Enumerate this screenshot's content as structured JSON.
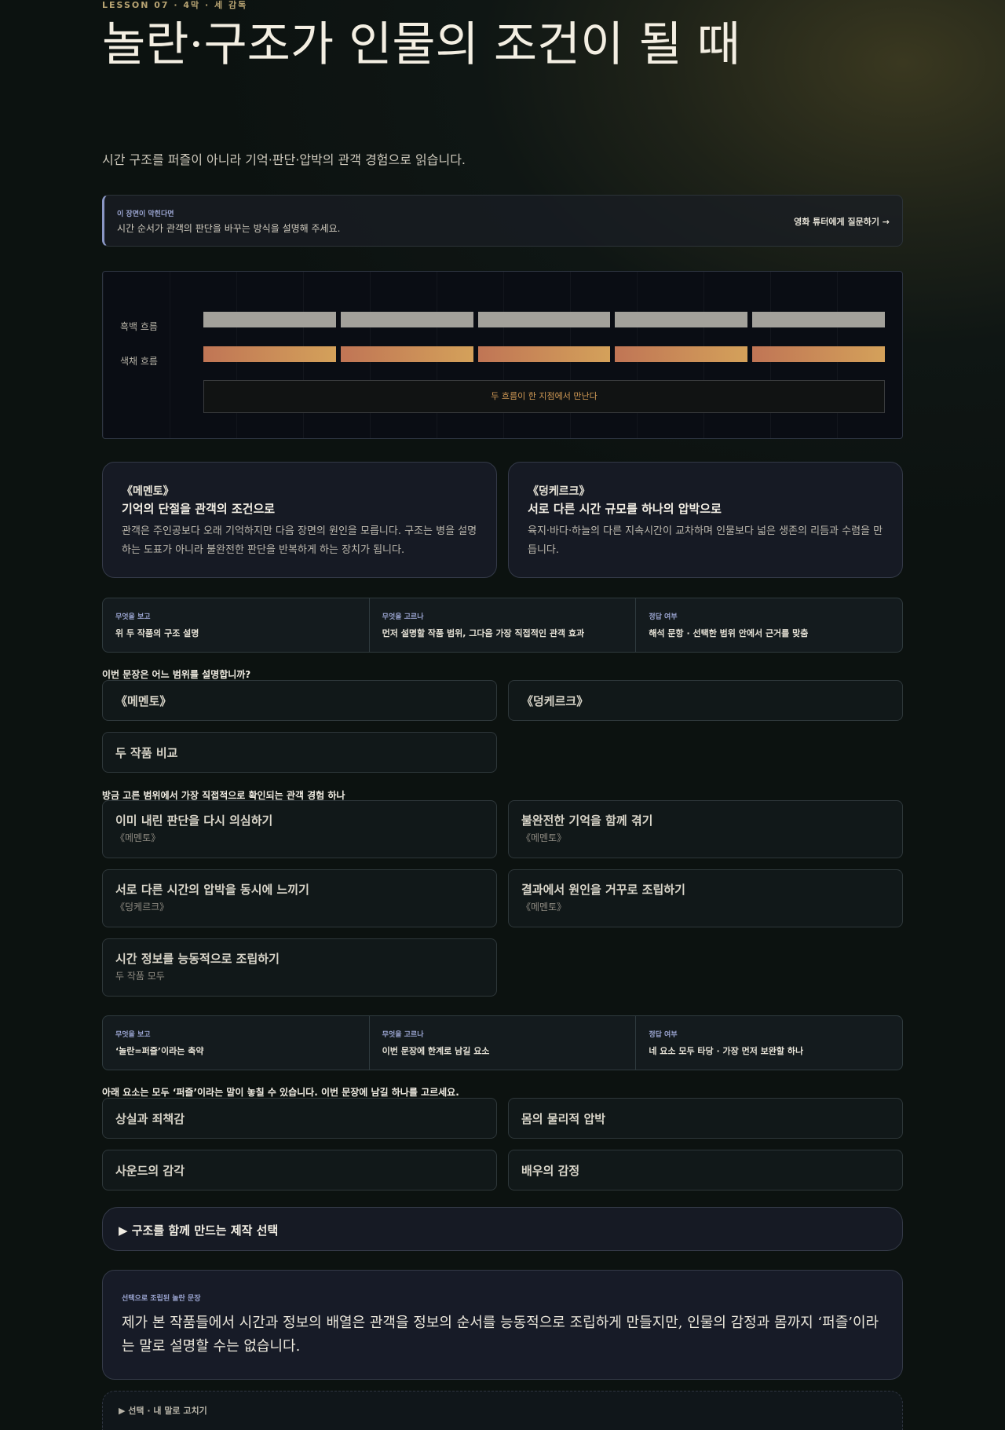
{
  "lesson": {
    "eyebrow": "LESSON 07 · 4막 · 세 감독"
  },
  "title": "놀란·구조가 인물의 조건이 될 때",
  "subtitle": "시간 구조를 퍼즐이 아니라 기억·판단·압박의 관객 경험으로 읽습니다.",
  "help": {
    "kicker": "이 장면이 막힌다면",
    "text": "시간 순서가 관객의 판단을 바꾸는 방식을 설명해 주세요.",
    "button": "영화 튜터에게 질문하기 →"
  },
  "timeline": {
    "row_bw": "흑백 흐름",
    "row_color": "색채 흐름",
    "meet": "두 흐름이 한 지점에서 만난다",
    "segments": 5,
    "colors": {
      "bw": "#a3a19b",
      "color_start": "#c07555",
      "color_end": "#d4a15a",
      "meet_text": "#d19a55"
    }
  },
  "films": [
    {
      "title": "《메멘토》",
      "heading": "기억의 단절을 관객의 조건으로",
      "body": "관객은 주인공보다 오래 기억하지만 다음 장면의 원인을 모릅니다. 구조는 병을 설명하는 도표가 아니라 불완전한 판단을 반복하게 하는 장치가 됩니다."
    },
    {
      "title": "《덩케르크》",
      "heading": "서로 다른 시간 규모를 하나의 압박으로",
      "body": "육지·바다·하늘의 다른 지속시간이 교차하며 인물보다 넓은 생존의 리듬과 수렴을 만듭니다."
    }
  ],
  "info1": {
    "cells": [
      {
        "k": "무엇을 보고",
        "v": "위 두 작품의 구조 설명"
      },
      {
        "k": "무엇을 고르나",
        "v": "먼저 설명할 작품 범위, 그다음 가장 직접적인 관객 효과"
      },
      {
        "k": "정답 여부",
        "v": "해석 문항 · 선택한 범위 안에서 근거를 맞춤"
      }
    ]
  },
  "q1": {
    "prompt": "이번 문장은 어느 범위를 설명합니까?",
    "options": [
      "《메멘토》",
      "《덩케르크》",
      "두 작품 비교"
    ]
  },
  "q2": {
    "prompt": "방금 고른 범위에서 가장 직접적으로 확인되는 관객 경험 하나",
    "options": [
      {
        "label": "이미 내린 판단을 다시 의심하기",
        "sub": "《메멘토》"
      },
      {
        "label": "불완전한 기억을 함께 겪기",
        "sub": "《메멘토》"
      },
      {
        "label": "서로 다른 시간의 압박을 동시에 느끼기",
        "sub": "《덩케르크》"
      },
      {
        "label": "결과에서 원인을 거꾸로 조립하기",
        "sub": "《메멘토》"
      },
      {
        "label": "시간 정보를 능동적으로 조립하기",
        "sub": "두 작품 모두"
      }
    ]
  },
  "info2": {
    "cells": [
      {
        "k": "무엇을 보고",
        "v": "‘놀란=퍼즐’이라는 축약"
      },
      {
        "k": "무엇을 고르나",
        "v": "이번 문장에 한계로 남길 요소"
      },
      {
        "k": "정답 여부",
        "v": "네 요소 모두 타당 · 가장 먼저 보완할 하나"
      }
    ]
  },
  "q3": {
    "prompt": "아래 요소는 모두 ‘퍼즐’이라는 말이 놓칠 수 있습니다. 이번 문장에 남길 하나를 고르세요.",
    "options": [
      "상실과 죄책감",
      "몸의 물리적 압박",
      "사운드의 감각",
      "배우의 감정"
    ]
  },
  "production": {
    "label": "▶ 구조를 함께 만드는 제작 선택"
  },
  "final": {
    "kicker": "선택으로 조립된 놀란 문장",
    "text": "제가 본 작품들에서 시간과 정보의 배열은 관객을 정보의 순서를 능동적으로 조립하게 만들지만, 인물의 감정과 몸까지 ‘퍼즐’이라는 말로 설명할 수는 없습니다."
  },
  "edit": {
    "label": "▶ 선택 · 내 말로 고치기"
  }
}
